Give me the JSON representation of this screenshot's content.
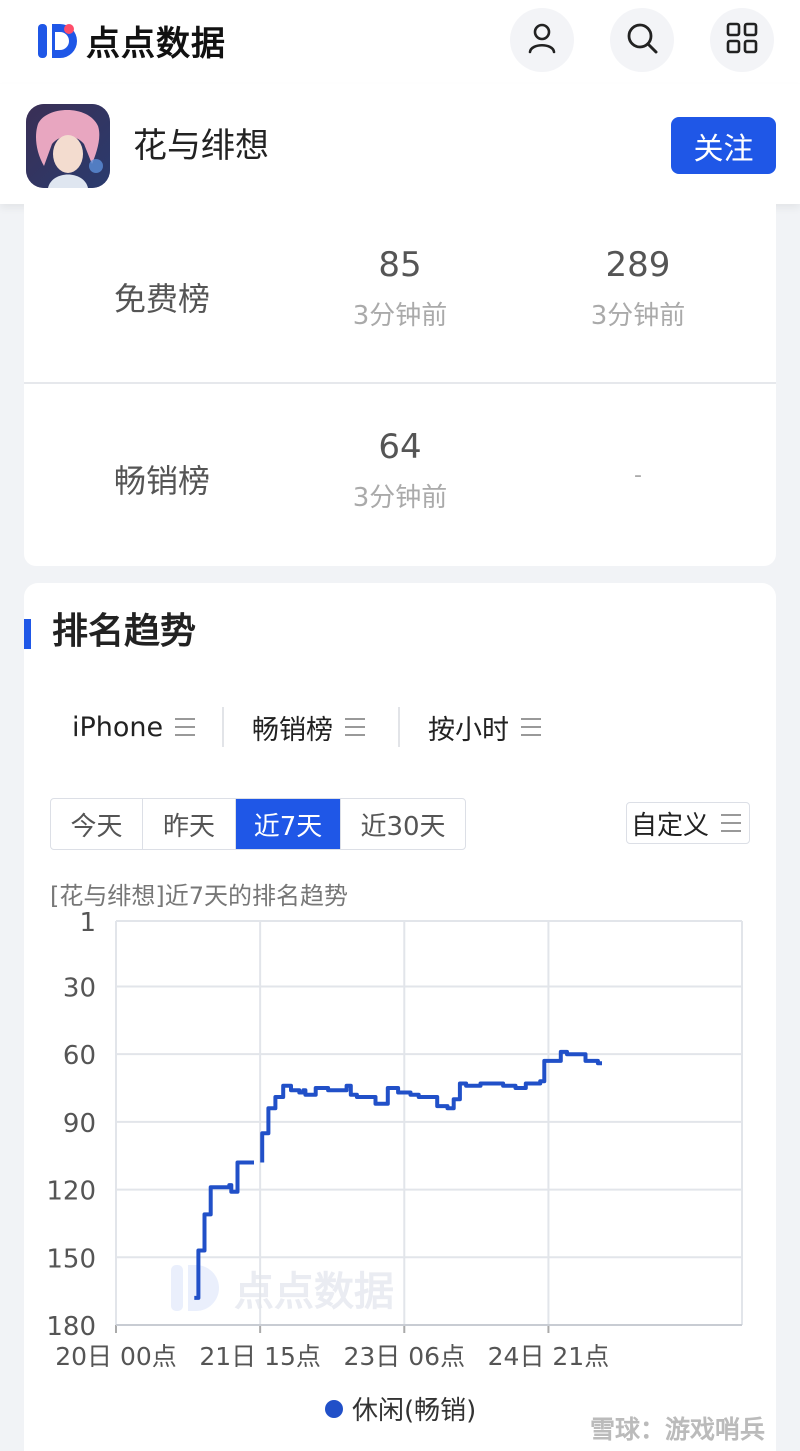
{
  "header": {
    "brand": "点点数据",
    "icons": [
      "user-icon",
      "search-icon",
      "grid-icon"
    ],
    "accent": "#1f57e7"
  },
  "app": {
    "name": "花与绯想",
    "follow_label": "关注"
  },
  "ranks": [
    {
      "name": "免费榜",
      "col1_value": "85",
      "col1_time": "3分钟前",
      "col2_value": "289",
      "col2_time": "3分钟前"
    },
    {
      "name": "畅销榜",
      "col1_value": "64",
      "col1_time": "3分钟前",
      "col2_value": "-",
      "col2_time": ""
    }
  ],
  "trend": {
    "title": "排名趋势",
    "filters": [
      "iPhone",
      "畅销榜",
      "按小时"
    ],
    "ranges": [
      "今天",
      "昨天",
      "近7天",
      "近30天"
    ],
    "active_range": "近7天",
    "custom_label": "自定义",
    "subtitle": "[花与绯想]近7天的排名趋势"
  },
  "chart_data": {
    "type": "line",
    "y_inverted": true,
    "ylim": [
      1,
      180
    ],
    "y_ticks": [
      "1",
      "30",
      "60",
      "90",
      "120",
      "150",
      "180"
    ],
    "x_tick_labels": [
      "20日 00点",
      "21日 15点",
      "23日 06点",
      "24日 21点"
    ],
    "x_range_hours": [
      0,
      152
    ],
    "grid": true,
    "legend": "bottom",
    "series": [
      {
        "name": "休闲(畅销)",
        "color": "#2150c8",
        "segments": [
          [
            [
              19.0,
              168
            ],
            [
              20.0,
              168
            ],
            [
              20.0,
              147
            ],
            [
              21.5,
              147
            ],
            [
              21.5,
              131
            ],
            [
              23.0,
              131
            ],
            [
              23.0,
              119
            ],
            [
              27.5,
              119
            ],
            [
              27.5,
              118
            ],
            [
              28.0,
              118
            ],
            [
              28.0,
              121
            ],
            [
              29.5,
              121
            ],
            [
              29.5,
              108
            ],
            [
              33.5,
              108
            ]
          ],
          [
            [
              35.5,
              108
            ],
            [
              35.5,
              95
            ],
            [
              37.0,
              95
            ],
            [
              37.0,
              84
            ],
            [
              38.7,
              84
            ],
            [
              38.7,
              79
            ],
            [
              40.6,
              79
            ],
            [
              40.6,
              74
            ],
            [
              42.5,
              74
            ],
            [
              42.5,
              76
            ],
            [
              44.5,
              76
            ],
            [
              44.5,
              77
            ],
            [
              45.5,
              77
            ],
            [
              45.5,
              76
            ],
            [
              46.0,
              76
            ],
            [
              46.0,
              78
            ],
            [
              48.5,
              78
            ],
            [
              48.5,
              75
            ],
            [
              51.5,
              75
            ],
            [
              51.5,
              76
            ],
            [
              56.0,
              76
            ],
            [
              56.0,
              74
            ],
            [
              57.0,
              74
            ],
            [
              57.0,
              78
            ],
            [
              58.5,
              78
            ],
            [
              58.5,
              79
            ],
            [
              63.0,
              79
            ],
            [
              63.0,
              82
            ],
            [
              66.0,
              82
            ],
            [
              66.0,
              75
            ],
            [
              68.5,
              75
            ],
            [
              68.5,
              77
            ],
            [
              71.5,
              77
            ],
            [
              71.5,
              78
            ],
            [
              73.5,
              78
            ],
            [
              73.5,
              79
            ],
            [
              78.0,
              79
            ],
            [
              78.0,
              83
            ],
            [
              80.5,
              83
            ],
            [
              80.5,
              84
            ],
            [
              82.0,
              84
            ],
            [
              82.0,
              80
            ],
            [
              83.5,
              80
            ],
            [
              83.5,
              73
            ],
            [
              85.0,
              73
            ],
            [
              85.0,
              74
            ],
            [
              88.5,
              74
            ],
            [
              88.5,
              73
            ],
            [
              94.0,
              73
            ],
            [
              94.0,
              74
            ],
            [
              97.0,
              74
            ],
            [
              97.0,
              75
            ],
            [
              99.5,
              75
            ],
            [
              99.5,
              73
            ],
            [
              103.0,
              73
            ],
            [
              103.0,
              72
            ],
            [
              104.0,
              72
            ],
            [
              104.0,
              63
            ],
            [
              108.0,
              63
            ],
            [
              108.0,
              59
            ],
            [
              109.5,
              59
            ],
            [
              109.5,
              60
            ],
            [
              114.0,
              60
            ],
            [
              114.0,
              63
            ],
            [
              117.0,
              63
            ],
            [
              117.0,
              64
            ],
            [
              118.0,
              64
            ]
          ]
        ]
      }
    ]
  },
  "watermarks": {
    "chart": "点点数据",
    "corner": "雪球：游戏哨兵"
  }
}
